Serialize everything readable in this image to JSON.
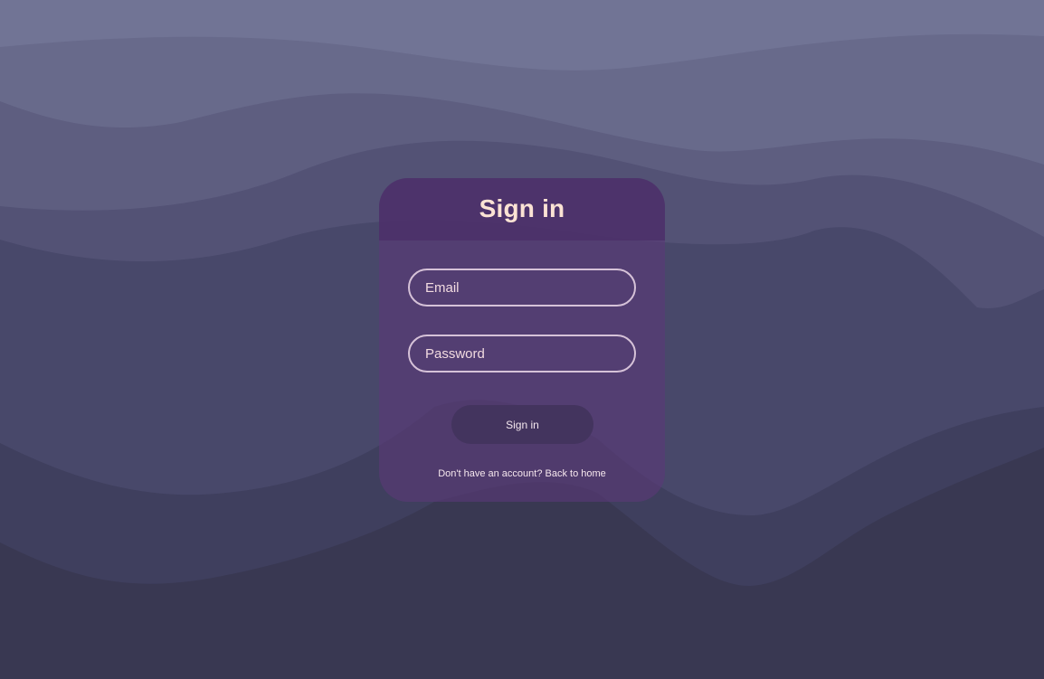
{
  "colors": {
    "accent": "#fbe3d4",
    "card": "#5a3878",
    "button": "#43345e",
    "background_top": "#717495",
    "background_bottom": "#393852"
  },
  "login": {
    "title": "Sign in",
    "email_placeholder": "Email",
    "password_placeholder": "Password",
    "submit_label": "Sign in",
    "prompt": "Don't have an account?",
    "back_link": "Back to home"
  }
}
